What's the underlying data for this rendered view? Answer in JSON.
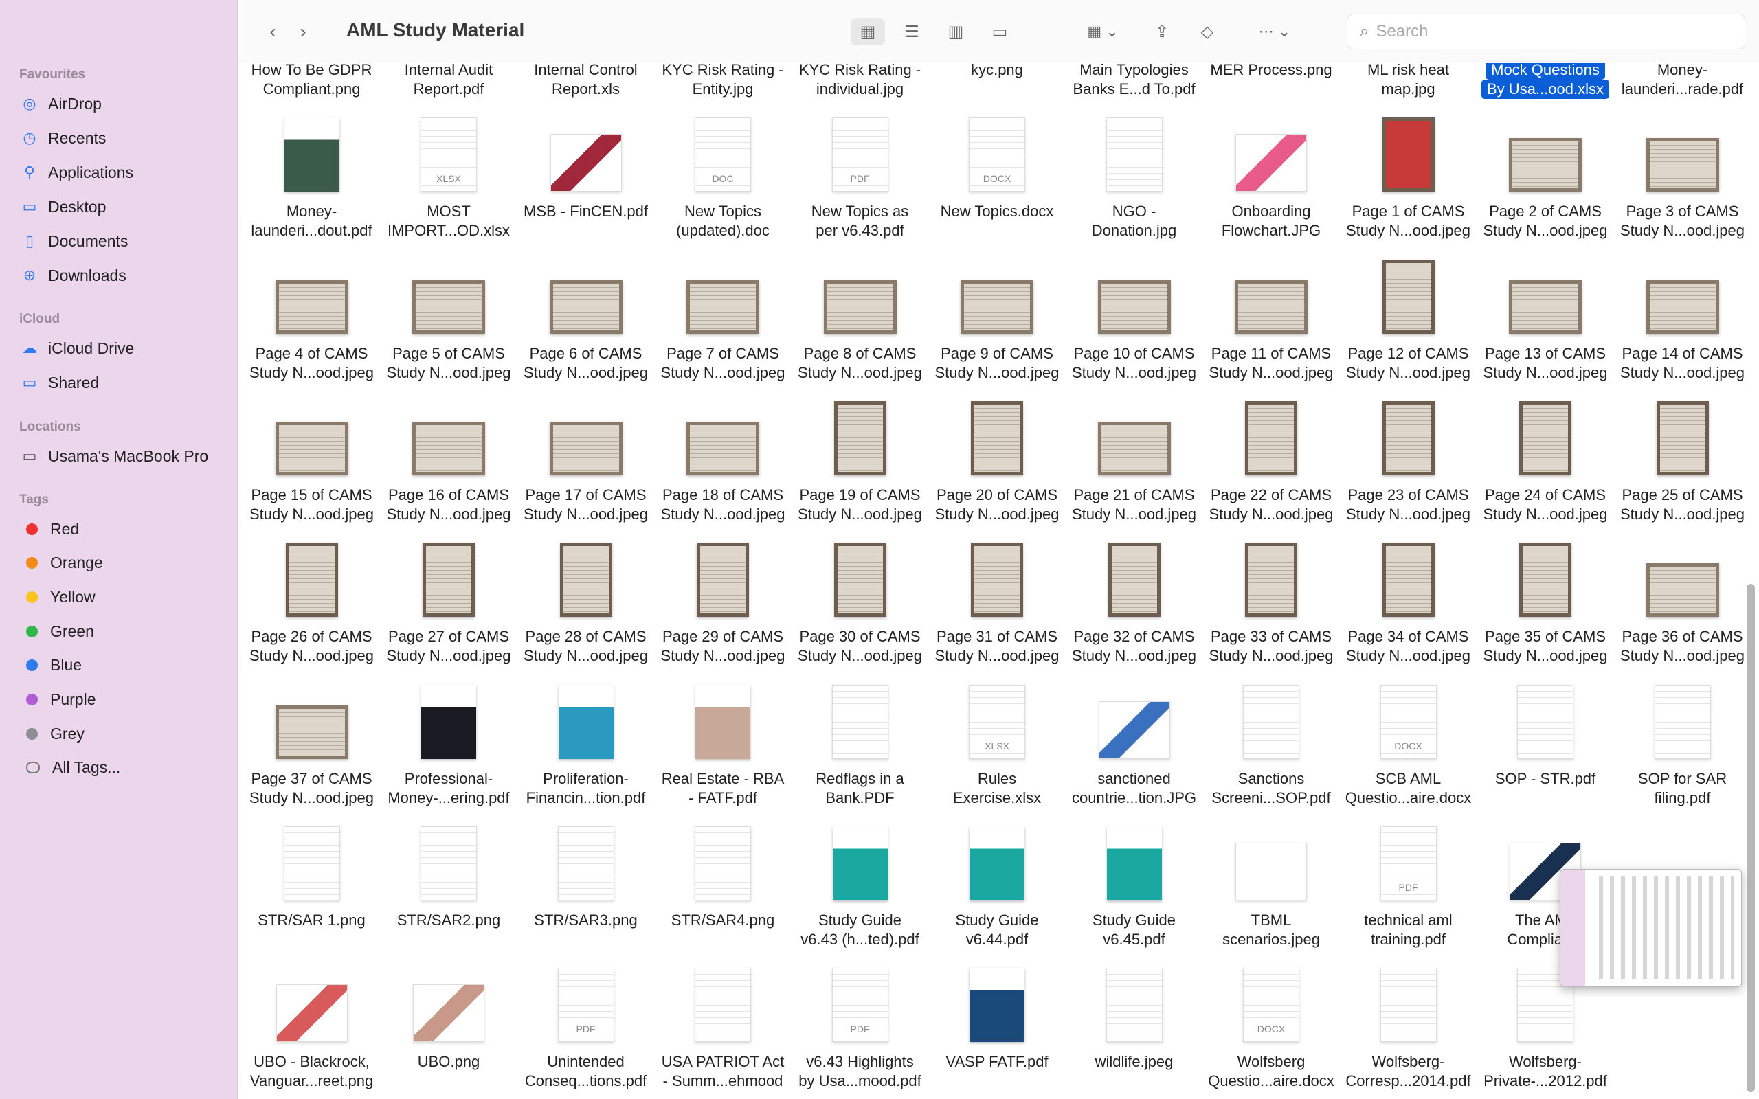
{
  "window": {
    "title": "AML Study Material",
    "search_placeholder": "Search"
  },
  "sidebar": {
    "favourites_label": "Favourites",
    "favourites": [
      {
        "label": "AirDrop",
        "icon": "airdrop-icon"
      },
      {
        "label": "Recents",
        "icon": "clock-icon"
      },
      {
        "label": "Applications",
        "icon": "applications-icon"
      },
      {
        "label": "Desktop",
        "icon": "desktop-icon"
      },
      {
        "label": "Documents",
        "icon": "document-icon"
      },
      {
        "label": "Downloads",
        "icon": "download-icon"
      }
    ],
    "icloud_label": "iCloud",
    "icloud": [
      {
        "label": "iCloud Drive",
        "icon": "cloud-icon"
      },
      {
        "label": "Shared",
        "icon": "shared-folder-icon"
      }
    ],
    "locations_label": "Locations",
    "locations": [
      {
        "label": "Usama's MacBook Pro",
        "icon": "laptop-icon"
      }
    ],
    "tags_label": "Tags",
    "tags": [
      {
        "label": "Red",
        "color": "#f0302e"
      },
      {
        "label": "Orange",
        "color": "#f48a1a"
      },
      {
        "label": "Yellow",
        "color": "#f7c51d"
      },
      {
        "label": "Green",
        "color": "#2fb84a"
      },
      {
        "label": "Blue",
        "color": "#2f7bf0"
      },
      {
        "label": "Purple",
        "color": "#b25bd6"
      },
      {
        "label": "Grey",
        "color": "#8e8e93"
      },
      {
        "label": "All Tags...",
        "color": ""
      }
    ]
  },
  "files": [
    [
      {
        "l": [
          "How To Be GDPR",
          "Compliant.png"
        ],
        "k": "img"
      },
      {
        "l": [
          "Internal Audit",
          "Report.pdf"
        ],
        "k": "page"
      },
      {
        "l": [
          "Internal Control",
          "Report.xls"
        ],
        "k": "page"
      },
      {
        "l": [
          "KYC Risk Rating -",
          "Entity.jpg"
        ],
        "k": "img"
      },
      {
        "l": [
          "KYC Risk Rating -",
          "individual.jpg"
        ],
        "k": "img"
      },
      {
        "l": [
          "kyc.png",
          ""
        ],
        "k": "img"
      },
      {
        "l": [
          "Main Typologies",
          "Banks E...d To.pdf"
        ],
        "k": "page"
      },
      {
        "l": [
          "MER Process.png",
          ""
        ],
        "k": "img"
      },
      {
        "l": [
          "ML risk heat",
          "map.jpg"
        ],
        "k": "img"
      },
      {
        "l": [
          "Mock Questions",
          "By Usa...ood.xlsx"
        ],
        "k": "page",
        "sel": true
      },
      {
        "l": [
          "Money-",
          "launderi...rade.pdf"
        ],
        "k": "page"
      }
    ],
    [
      {
        "l": [
          "Money-",
          "launderi...dout.pdf"
        ],
        "k": "cover",
        "c": "#3a5a4a"
      },
      {
        "l": [
          "MOST",
          "IMPORT...OD.xlsx"
        ],
        "k": "page",
        "b": "XLSX"
      },
      {
        "l": [
          "MSB - FinCEN.pdf",
          ""
        ],
        "k": "img",
        "c": "#a0283a"
      },
      {
        "l": [
          "New Topics",
          "(updated).doc"
        ],
        "k": "page",
        "b": "DOC"
      },
      {
        "l": [
          "New Topics as",
          "per v6.43.pdf"
        ],
        "k": "page",
        "b": "PDF"
      },
      {
        "l": [
          "New Topics.docx",
          ""
        ],
        "k": "page",
        "b": "DOCX"
      },
      {
        "l": [
          "NGO -",
          "Donation.jpg"
        ],
        "k": "page"
      },
      {
        "l": [
          "Onboarding",
          "Flowchart.JPG"
        ],
        "k": "img",
        "c": "#e85a8a"
      },
      {
        "l": [
          "Page 1 of CAMS",
          "Study N...ood.jpeg"
        ],
        "k": "scanP",
        "c": "#c83a3a"
      },
      {
        "l": [
          "Page 2 of CAMS",
          "Study N...ood.jpeg"
        ],
        "k": "scanL"
      },
      {
        "l": [
          "Page 3 of CAMS",
          "Study N...ood.jpeg"
        ],
        "k": "scanL"
      }
    ],
    [
      {
        "l": [
          "Page 4 of CAMS",
          "Study N...ood.jpeg"
        ],
        "k": "scanL"
      },
      {
        "l": [
          "Page 5 of CAMS",
          "Study N...ood.jpeg"
        ],
        "k": "scanL"
      },
      {
        "l": [
          "Page 6 of CAMS",
          "Study N...ood.jpeg"
        ],
        "k": "scanL"
      },
      {
        "l": [
          "Page 7 of CAMS",
          "Study N...ood.jpeg"
        ],
        "k": "scanL"
      },
      {
        "l": [
          "Page 8 of CAMS",
          "Study N...ood.jpeg"
        ],
        "k": "scanL"
      },
      {
        "l": [
          "Page 9 of CAMS",
          "Study N...ood.jpeg"
        ],
        "k": "scanL"
      },
      {
        "l": [
          "Page 10 of CAMS",
          "Study N...ood.jpeg"
        ],
        "k": "scanL"
      },
      {
        "l": [
          "Page 11 of CAMS",
          "Study N...ood.jpeg"
        ],
        "k": "scanL"
      },
      {
        "l": [
          "Page 12 of CAMS",
          "Study N...ood.jpeg"
        ],
        "k": "scanP"
      },
      {
        "l": [
          "Page 13 of CAMS",
          "Study N...ood.jpeg"
        ],
        "k": "scanL"
      },
      {
        "l": [
          "Page 14 of CAMS",
          "Study N...ood.jpeg"
        ],
        "k": "scanL"
      }
    ],
    [
      {
        "l": [
          "Page 15 of CAMS",
          "Study N...ood.jpeg"
        ],
        "k": "scanL"
      },
      {
        "l": [
          "Page 16 of CAMS",
          "Study N...ood.jpeg"
        ],
        "k": "scanL"
      },
      {
        "l": [
          "Page 17 of CAMS",
          "Study N...ood.jpeg"
        ],
        "k": "scanL"
      },
      {
        "l": [
          "Page 18 of CAMS",
          "Study N...ood.jpeg"
        ],
        "k": "scanL"
      },
      {
        "l": [
          "Page 19 of CAMS",
          "Study N...ood.jpeg"
        ],
        "k": "scanP"
      },
      {
        "l": [
          "Page 20 of CAMS",
          "Study N...ood.jpeg"
        ],
        "k": "scanP"
      },
      {
        "l": [
          "Page 21 of CAMS",
          "Study N...ood.jpeg"
        ],
        "k": "scanL"
      },
      {
        "l": [
          "Page 22 of CAMS",
          "Study N...ood.jpeg"
        ],
        "k": "scanP"
      },
      {
        "l": [
          "Page 23 of CAMS",
          "Study N...ood.jpeg"
        ],
        "k": "scanP"
      },
      {
        "l": [
          "Page 24 of CAMS",
          "Study N...ood.jpeg"
        ],
        "k": "scanP"
      },
      {
        "l": [
          "Page 25 of CAMS",
          "Study N...ood.jpeg"
        ],
        "k": "scanP"
      }
    ],
    [
      {
        "l": [
          "Page 26 of CAMS",
          "Study N...ood.jpeg"
        ],
        "k": "scanP"
      },
      {
        "l": [
          "Page 27 of CAMS",
          "Study N...ood.jpeg"
        ],
        "k": "scanP"
      },
      {
        "l": [
          "Page 28 of CAMS",
          "Study N...ood.jpeg"
        ],
        "k": "scanP"
      },
      {
        "l": [
          "Page 29 of CAMS",
          "Study N...ood.jpeg"
        ],
        "k": "scanP"
      },
      {
        "l": [
          "Page 30 of CAMS",
          "Study N...ood.jpeg"
        ],
        "k": "scanP"
      },
      {
        "l": [
          "Page 31 of CAMS",
          "Study N...ood.jpeg"
        ],
        "k": "scanP"
      },
      {
        "l": [
          "Page 32 of CAMS",
          "Study N...ood.jpeg"
        ],
        "k": "scanP"
      },
      {
        "l": [
          "Page 33 of CAMS",
          "Study N...ood.jpeg"
        ],
        "k": "scanP"
      },
      {
        "l": [
          "Page 34 of CAMS",
          "Study N...ood.jpeg"
        ],
        "k": "scanP"
      },
      {
        "l": [
          "Page 35 of CAMS",
          "Study N...ood.jpeg"
        ],
        "k": "scanP"
      },
      {
        "l": [
          "Page 36 of CAMS",
          "Study N...ood.jpeg"
        ],
        "k": "scanL"
      }
    ],
    [
      {
        "l": [
          "Page 37 of CAMS",
          "Study N...ood.jpeg"
        ],
        "k": "scanL"
      },
      {
        "l": [
          "Professional-",
          "Money-...ering.pdf"
        ],
        "k": "cover",
        "c": "#1a1a22"
      },
      {
        "l": [
          "Proliferation-",
          "Financin...tion.pdf"
        ],
        "k": "cover",
        "c": "#2a9ac0"
      },
      {
        "l": [
          "Real Estate - RBA",
          "- FATF.pdf"
        ],
        "k": "cover",
        "c": "#c8a898"
      },
      {
        "l": [
          "Redflags in a",
          "Bank.PDF"
        ],
        "k": "page"
      },
      {
        "l": [
          "Rules",
          "Exercise.xlsx"
        ],
        "k": "page",
        "b": "XLSX"
      },
      {
        "l": [
          "sanctioned",
          "countrie...tion.JPG"
        ],
        "k": "img",
        "c": "#3a70c0"
      },
      {
        "l": [
          "Sanctions",
          "Screeni...SOP.pdf"
        ],
        "k": "page"
      },
      {
        "l": [
          "SCB AML",
          "Questio...aire.docx"
        ],
        "k": "page",
        "b": "DOCX"
      },
      {
        "l": [
          "SOP - STR.pdf",
          ""
        ],
        "k": "page"
      },
      {
        "l": [
          "SOP for SAR",
          "filing.pdf"
        ],
        "k": "page"
      }
    ],
    [
      {
        "l": [
          "STR/SAR 1.png",
          ""
        ],
        "k": "page"
      },
      {
        "l": [
          "STR/SAR2.png",
          ""
        ],
        "k": "page"
      },
      {
        "l": [
          "STR/SAR3.png",
          ""
        ],
        "k": "page"
      },
      {
        "l": [
          "STR/SAR4.png",
          ""
        ],
        "k": "page"
      },
      {
        "l": [
          "Study Guide",
          "v6.43 (h...ted).pdf"
        ],
        "k": "cover",
        "c": "#1aa8a0"
      },
      {
        "l": [
          "Study Guide",
          "v6.44.pdf"
        ],
        "k": "cover",
        "c": "#1aa8a0"
      },
      {
        "l": [
          "Study Guide",
          "v6.45.pdf"
        ],
        "k": "cover",
        "c": "#1aa8a0"
      },
      {
        "l": [
          "TBML",
          "scenarios.jpeg"
        ],
        "k": "img"
      },
      {
        "l": [
          "technical aml",
          "training.pdf"
        ],
        "k": "page",
        "b": "PDF"
      },
      {
        "l": [
          "The AML",
          "Complia...n"
        ],
        "k": "img",
        "c": "#1a3050"
      }
    ],
    [
      {
        "l": [
          "UBO - Blackrock,",
          "Vanguar...reet.png"
        ],
        "k": "img",
        "c": "#d85a5a"
      },
      {
        "l": [
          "UBO.png",
          ""
        ],
        "k": "img",
        "c": "#c89888"
      },
      {
        "l": [
          "Unintended",
          "Conseq...tions.pdf"
        ],
        "k": "page",
        "b": "PDF"
      },
      {
        "l": [
          "USA PATRIOT Act",
          "- Summ...ehmood"
        ],
        "k": "page"
      },
      {
        "l": [
          "v6.43 Highlights",
          "by Usa...mood.pdf"
        ],
        "k": "page",
        "b": "PDF"
      },
      {
        "l": [
          "VASP FATF.pdf",
          ""
        ],
        "k": "cover",
        "c": "#1a4a7a"
      },
      {
        "l": [
          "wildlife.jpeg",
          ""
        ],
        "k": "page"
      },
      {
        "l": [
          "Wolfsberg",
          "Questio...aire.docx"
        ],
        "k": "page",
        "b": "DOCX"
      },
      {
        "l": [
          "Wolfsberg-",
          "Corresp...2014.pdf"
        ],
        "k": "page"
      },
      {
        "l": [
          "Wolfsberg-",
          "Private-...2012.pdf"
        ],
        "k": "page"
      }
    ]
  ]
}
